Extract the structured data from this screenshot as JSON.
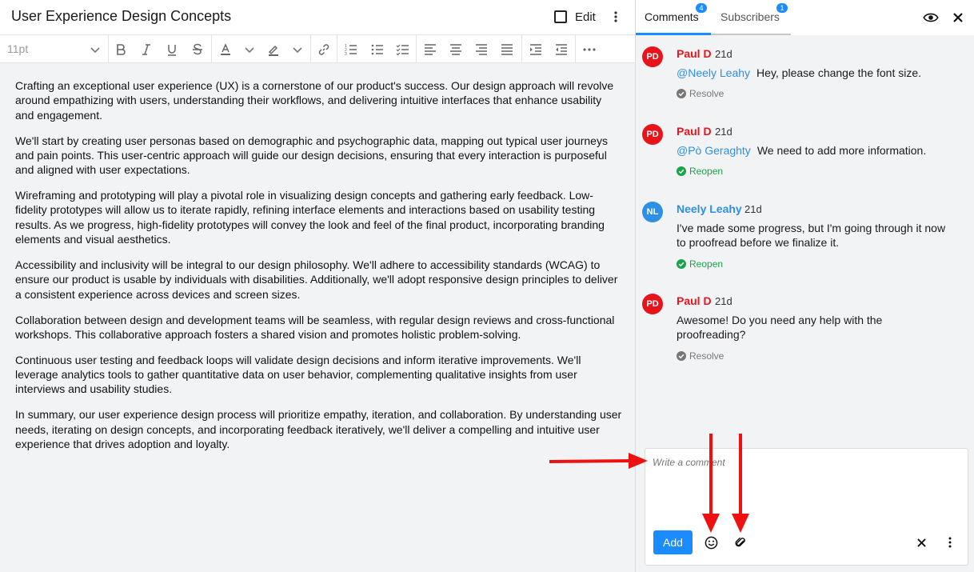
{
  "document": {
    "title": "User Experience Design Concepts",
    "edit_label": "Edit",
    "font_size": "11pt",
    "paragraphs": [
      "Crafting an exceptional user experience (UX) is a cornerstone of our product's success. Our design approach will revolve around empathizing with users, understanding their workflows, and delivering intuitive interfaces that enhance usability and engagement.",
      "We'll start by creating user personas based on demographic and psychographic data, mapping out typical user journeys and pain points. This user-centric approach will guide our design decisions, ensuring that every interaction is purposeful and aligned with user expectations.",
      "Wireframing and prototyping will play a pivotal role in visualizing design concepts and gathering early feedback. Low-fidelity prototypes will allow us to iterate rapidly, refining interface elements and interactions based on usability testing results. As we progress, high-fidelity prototypes will convey the look and feel of the final product, incorporating branding elements and visual aesthetics.",
      "Accessibility and inclusivity will be integral to our design philosophy. We'll adhere to accessibility standards (WCAG) to ensure our product is usable by individuals with disabilities. Additionally, we'll adopt responsive design principles to deliver a consistent experience across devices and screen sizes.",
      "Collaboration between design and development teams will be seamless, with regular design reviews and cross-functional workshops. This collaborative approach fosters a shared vision and promotes holistic problem-solving.",
      "Continuous user testing and feedback loops will validate design decisions and inform iterative improvements. We'll leverage analytics tools to gather quantitative data on user behavior, complementing qualitative insights from user interviews and usability studies.",
      "In summary, our user experience design process will prioritize empathy, iteration, and collaboration. By understanding user needs, iterating on design concepts, and incorporating feedback iteratively, we'll deliver a compelling and intuitive user experience that drives adoption and loyalty."
    ]
  },
  "panel": {
    "tabs": [
      {
        "label": "Comments",
        "badge": "4"
      },
      {
        "label": "Subscribers",
        "badge": "1"
      }
    ],
    "comments": [
      {
        "initials": "PD",
        "author": "Paul D",
        "time": "21d",
        "mention": "@Neely Leahy",
        "text": "Hey, please change the font size.",
        "action": "Resolve"
      },
      {
        "initials": "PD",
        "author": "Paul D",
        "time": "21d",
        "mention": "@Pò Geraghty",
        "text": "We need to add more information.",
        "action": "Reopen"
      },
      {
        "initials": "NL",
        "author": "Neely Leahy",
        "time": "21d",
        "mention": "",
        "text": "I've made some progress, but I'm going through it now to proofread before we finalize it.",
        "action": "Reopen"
      },
      {
        "initials": "PD",
        "author": "Paul D",
        "time": "21d",
        "mention": "",
        "text": "Awesome! Do you need any help with the proofreading?",
        "action": "Resolve"
      }
    ],
    "composer": {
      "placeholder": "Write a comment",
      "add_label": "Add"
    }
  },
  "colors": {
    "accent": "#1a8cff",
    "avatar_pd": "#e8141b",
    "avatar_nl": "#2e8fe6",
    "reopen_green": "#1aa34a",
    "annotation_arrow": "#ee1111"
  },
  "icons": [
    "kebab-icon",
    "bold-icon",
    "italic-icon",
    "underline-icon",
    "strikethrough-icon",
    "font-color-icon",
    "highlight-icon",
    "link-icon",
    "ordered-list-icon",
    "bullet-list-icon",
    "checklist-icon",
    "align-left-icon",
    "align-center-icon",
    "align-right-icon",
    "justify-icon",
    "indent-icon",
    "outdent-icon",
    "more-icon",
    "eye-icon",
    "close-icon",
    "check-circle-icon",
    "emoji-icon",
    "attachment-icon"
  ]
}
